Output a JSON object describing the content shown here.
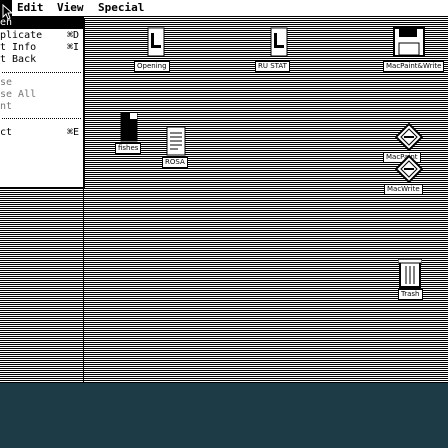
{
  "menubar": {
    "items": [
      {
        "label": "Edit"
      },
      {
        "label": "View"
      },
      {
        "label": "Special"
      }
    ]
  },
  "dropdown": {
    "items": [
      {
        "label": "en",
        "shortcut": ""
      },
      {
        "label": "plicate",
        "shortcut": "⌘D"
      },
      {
        "label": "t Info",
        "shortcut": "⌘I"
      },
      {
        "label": "t Back",
        "shortcut": ""
      },
      {
        "label": "se",
        "shortcut": ""
      },
      {
        "label": "se All",
        "shortcut": ""
      },
      {
        "label": "nt",
        "shortcut": ""
      },
      {
        "label": "ct",
        "shortcut": "⌘E"
      }
    ]
  },
  "icons": [
    {
      "id": "opening",
      "label": "Opening"
    },
    {
      "id": "ru-stat",
      "label": "RU STAT"
    },
    {
      "id": "macpaint-write",
      "label": "MacPaint&Write"
    },
    {
      "id": "fishes",
      "label": "fishes"
    },
    {
      "id": "rosa",
      "label": "ROSA"
    },
    {
      "id": "macpaint",
      "label": "MacPaint"
    },
    {
      "id": "macwrite",
      "label": "MacWrite"
    },
    {
      "id": "trash",
      "label": "Trash"
    }
  ]
}
